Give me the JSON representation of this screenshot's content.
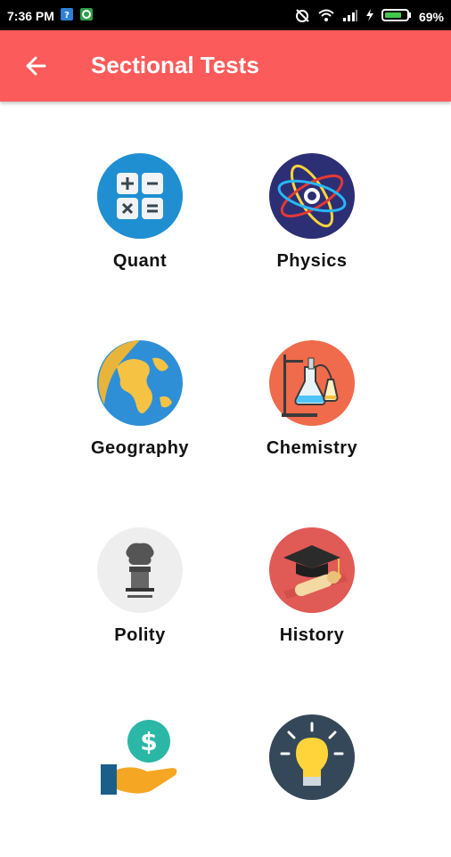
{
  "status_bar": {
    "time": "7:36 PM",
    "battery": "69%"
  },
  "app_bar": {
    "title": "Sectional Tests"
  },
  "tiles": [
    {
      "label": "Quant",
      "icon": "calculator-icon"
    },
    {
      "label": "Physics",
      "icon": "atom-icon"
    },
    {
      "label": "Geography",
      "icon": "globe-icon"
    },
    {
      "label": "Chemistry",
      "icon": "lab-flask-icon"
    },
    {
      "label": "Polity",
      "icon": "national-emblem-icon"
    },
    {
      "label": "History",
      "icon": "graduation-cap-scroll-icon"
    },
    {
      "label": "",
      "icon": "money-hand-icon"
    },
    {
      "label": "",
      "icon": "lightbulb-icon"
    }
  ],
  "colors": {
    "app_bar": "#fb5b5a",
    "status_bar": "#000000"
  }
}
